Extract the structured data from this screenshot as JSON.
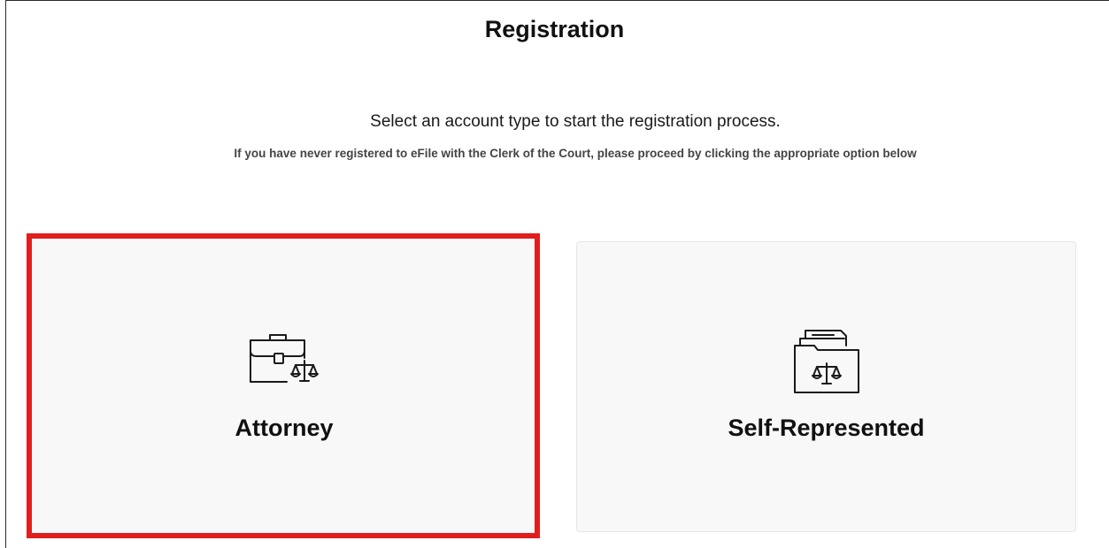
{
  "page": {
    "title": "Registration",
    "subtitle": "Select an account type to start the registration process.",
    "instruction": "If you have never registered to eFile with the Clerk of the Court, please proceed by clicking the appropriate option below"
  },
  "account_types": [
    {
      "label": "Attorney",
      "icon": "briefcase-scales-icon",
      "highlighted": true
    },
    {
      "label": "Self-Represented",
      "icon": "folder-scales-icon",
      "highlighted": false
    }
  ],
  "colors": {
    "highlight": "#e01e1e",
    "card_background": "#f8f8f8",
    "text": "#111111"
  }
}
